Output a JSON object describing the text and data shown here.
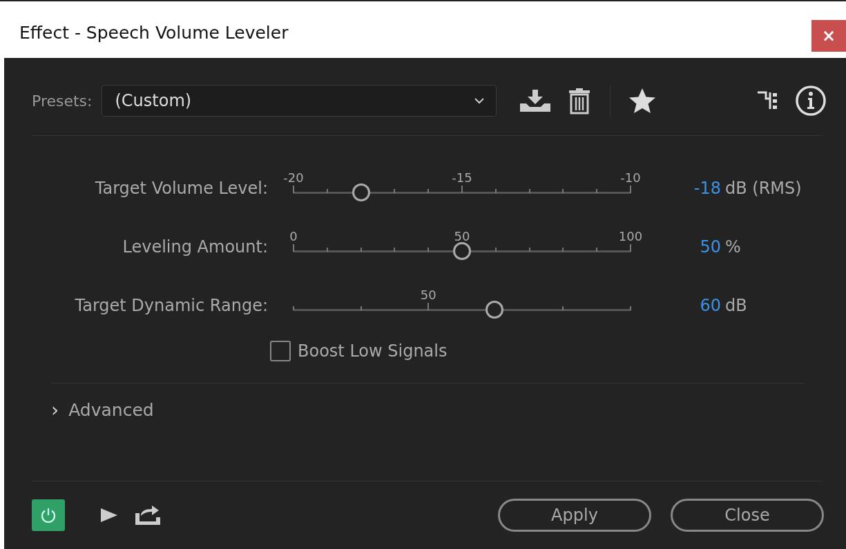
{
  "window": {
    "title": "Effect - Speech Volume Leveler",
    "close": "×"
  },
  "presets": {
    "label": "Presets:",
    "value": "(Custom)"
  },
  "sliders": [
    {
      "label": "Target Volume Level:",
      "level": 0.2,
      "value": "-18",
      "unit": "dB (RMS)",
      "ticks": [
        {
          "kind": "major",
          "label": "-20"
        },
        {
          "kind": "minor"
        },
        {
          "kind": "minor"
        },
        {
          "kind": "minor"
        },
        {
          "kind": "minor"
        },
        {
          "kind": "major",
          "label": "-15"
        },
        {
          "kind": "minor"
        },
        {
          "kind": "minor"
        },
        {
          "kind": "minor"
        },
        {
          "kind": "minor"
        },
        {
          "kind": "major",
          "label": "-10"
        }
      ]
    },
    {
      "label": "Leveling Amount:",
      "level": 0.5,
      "value": "50",
      "unit": "%",
      "ticks": [
        {
          "kind": "major",
          "label": "0"
        },
        {
          "kind": "minor"
        },
        {
          "kind": "minor"
        },
        {
          "kind": "minor"
        },
        {
          "kind": "minor"
        },
        {
          "kind": "major",
          "label": "50"
        },
        {
          "kind": "minor"
        },
        {
          "kind": "minor"
        },
        {
          "kind": "minor"
        },
        {
          "kind": "minor"
        },
        {
          "kind": "major",
          "label": "100"
        }
      ]
    },
    {
      "label": "Target Dynamic Range:",
      "level": 0.597,
      "value": "60",
      "unit": "dB",
      "ticks": [
        {
          "kind": "minor"
        },
        {
          "kind": "minor"
        },
        {
          "kind": "major",
          "label": "50"
        },
        {
          "kind": "minor"
        },
        {
          "kind": "minor"
        },
        {
          "kind": "minor"
        }
      ]
    }
  ],
  "boost": {
    "label": "Boost Low Signals",
    "checked": false
  },
  "advanced": {
    "label": "Advanced",
    "expanded": false,
    "caret": "›"
  },
  "power": {
    "on": true
  },
  "buttons": [
    "Apply",
    "Close"
  ]
}
